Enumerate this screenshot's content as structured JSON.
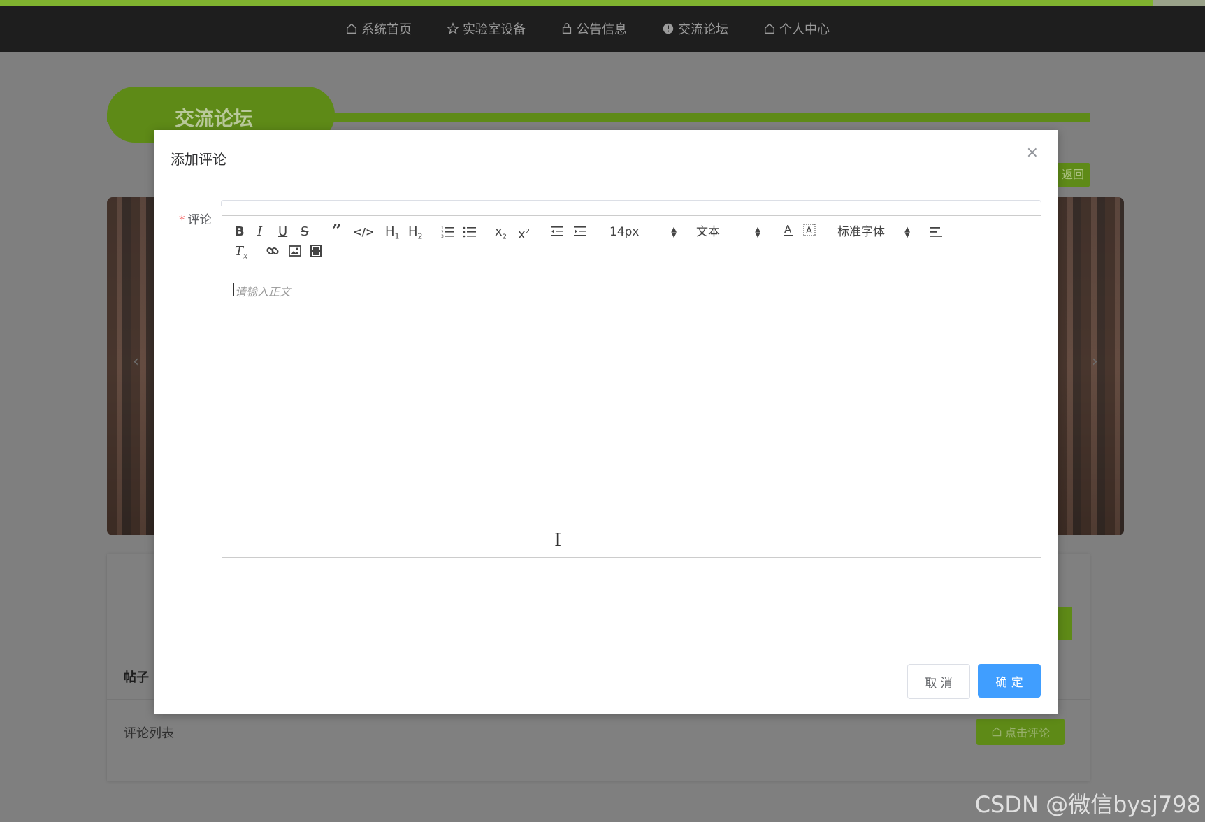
{
  "nav": {
    "items": [
      {
        "label": "系统首页",
        "icon": "home-icon"
      },
      {
        "label": "实验室设备",
        "icon": "star-icon"
      },
      {
        "label": "公告信息",
        "icon": "bag-icon"
      },
      {
        "label": "交流论坛",
        "icon": "info-icon"
      },
      {
        "label": "个人中心",
        "icon": "home-icon"
      }
    ]
  },
  "page": {
    "section_title": "交流论坛",
    "back_label": "返回",
    "post_label": "帖子",
    "comment_list_label": "评论列表",
    "click_comment_label": "点击评论"
  },
  "dialog": {
    "title": "添加评论",
    "close": "×",
    "field_label": "评论",
    "required_mark": "*",
    "editor": {
      "font_size": "14px",
      "header_picker": "文本",
      "font_family": "标准字体",
      "h1": "H",
      "h2": "H",
      "placeholder": "请输入正文"
    },
    "cancel_label": "取 消",
    "confirm_label": "确 定"
  },
  "watermark": "CSDN @微信bysj798",
  "colors": {
    "nav_bg": "#1e1e1e",
    "brand_green": "#5e8a17",
    "primary_blue": "#409eff"
  }
}
